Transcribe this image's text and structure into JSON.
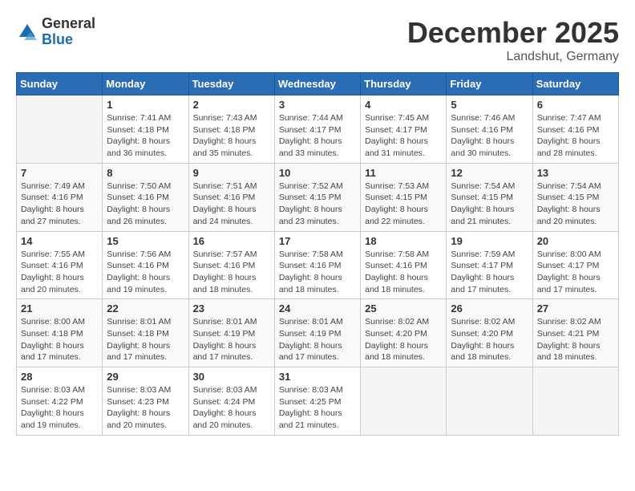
{
  "logo": {
    "general": "General",
    "blue": "Blue"
  },
  "title": "December 2025",
  "location": "Landshut, Germany",
  "weekdays": [
    "Sunday",
    "Monday",
    "Tuesday",
    "Wednesday",
    "Thursday",
    "Friday",
    "Saturday"
  ],
  "weeks": [
    [
      {
        "day": "",
        "info": ""
      },
      {
        "day": "1",
        "info": "Sunrise: 7:41 AM\nSunset: 4:18 PM\nDaylight: 8 hours\nand 36 minutes."
      },
      {
        "day": "2",
        "info": "Sunrise: 7:43 AM\nSunset: 4:18 PM\nDaylight: 8 hours\nand 35 minutes."
      },
      {
        "day": "3",
        "info": "Sunrise: 7:44 AM\nSunset: 4:17 PM\nDaylight: 8 hours\nand 33 minutes."
      },
      {
        "day": "4",
        "info": "Sunrise: 7:45 AM\nSunset: 4:17 PM\nDaylight: 8 hours\nand 31 minutes."
      },
      {
        "day": "5",
        "info": "Sunrise: 7:46 AM\nSunset: 4:16 PM\nDaylight: 8 hours\nand 30 minutes."
      },
      {
        "day": "6",
        "info": "Sunrise: 7:47 AM\nSunset: 4:16 PM\nDaylight: 8 hours\nand 28 minutes."
      }
    ],
    [
      {
        "day": "7",
        "info": "Sunrise: 7:49 AM\nSunset: 4:16 PM\nDaylight: 8 hours\nand 27 minutes."
      },
      {
        "day": "8",
        "info": "Sunrise: 7:50 AM\nSunset: 4:16 PM\nDaylight: 8 hours\nand 26 minutes."
      },
      {
        "day": "9",
        "info": "Sunrise: 7:51 AM\nSunset: 4:16 PM\nDaylight: 8 hours\nand 24 minutes."
      },
      {
        "day": "10",
        "info": "Sunrise: 7:52 AM\nSunset: 4:15 PM\nDaylight: 8 hours\nand 23 minutes."
      },
      {
        "day": "11",
        "info": "Sunrise: 7:53 AM\nSunset: 4:15 PM\nDaylight: 8 hours\nand 22 minutes."
      },
      {
        "day": "12",
        "info": "Sunrise: 7:54 AM\nSunset: 4:15 PM\nDaylight: 8 hours\nand 21 minutes."
      },
      {
        "day": "13",
        "info": "Sunrise: 7:54 AM\nSunset: 4:15 PM\nDaylight: 8 hours\nand 20 minutes."
      }
    ],
    [
      {
        "day": "14",
        "info": "Sunrise: 7:55 AM\nSunset: 4:16 PM\nDaylight: 8 hours\nand 20 minutes."
      },
      {
        "day": "15",
        "info": "Sunrise: 7:56 AM\nSunset: 4:16 PM\nDaylight: 8 hours\nand 19 minutes."
      },
      {
        "day": "16",
        "info": "Sunrise: 7:57 AM\nSunset: 4:16 PM\nDaylight: 8 hours\nand 18 minutes."
      },
      {
        "day": "17",
        "info": "Sunrise: 7:58 AM\nSunset: 4:16 PM\nDaylight: 8 hours\nand 18 minutes."
      },
      {
        "day": "18",
        "info": "Sunrise: 7:58 AM\nSunset: 4:16 PM\nDaylight: 8 hours\nand 18 minutes."
      },
      {
        "day": "19",
        "info": "Sunrise: 7:59 AM\nSunset: 4:17 PM\nDaylight: 8 hours\nand 17 minutes."
      },
      {
        "day": "20",
        "info": "Sunrise: 8:00 AM\nSunset: 4:17 PM\nDaylight: 8 hours\nand 17 minutes."
      }
    ],
    [
      {
        "day": "21",
        "info": "Sunrise: 8:00 AM\nSunset: 4:18 PM\nDaylight: 8 hours\nand 17 minutes."
      },
      {
        "day": "22",
        "info": "Sunrise: 8:01 AM\nSunset: 4:18 PM\nDaylight: 8 hours\nand 17 minutes."
      },
      {
        "day": "23",
        "info": "Sunrise: 8:01 AM\nSunset: 4:19 PM\nDaylight: 8 hours\nand 17 minutes."
      },
      {
        "day": "24",
        "info": "Sunrise: 8:01 AM\nSunset: 4:19 PM\nDaylight: 8 hours\nand 17 minutes."
      },
      {
        "day": "25",
        "info": "Sunrise: 8:02 AM\nSunset: 4:20 PM\nDaylight: 8 hours\nand 18 minutes."
      },
      {
        "day": "26",
        "info": "Sunrise: 8:02 AM\nSunset: 4:20 PM\nDaylight: 8 hours\nand 18 minutes."
      },
      {
        "day": "27",
        "info": "Sunrise: 8:02 AM\nSunset: 4:21 PM\nDaylight: 8 hours\nand 18 minutes."
      }
    ],
    [
      {
        "day": "28",
        "info": "Sunrise: 8:03 AM\nSunset: 4:22 PM\nDaylight: 8 hours\nand 19 minutes."
      },
      {
        "day": "29",
        "info": "Sunrise: 8:03 AM\nSunset: 4:23 PM\nDaylight: 8 hours\nand 20 minutes."
      },
      {
        "day": "30",
        "info": "Sunrise: 8:03 AM\nSunset: 4:24 PM\nDaylight: 8 hours\nand 20 minutes."
      },
      {
        "day": "31",
        "info": "Sunrise: 8:03 AM\nSunset: 4:25 PM\nDaylight: 8 hours\nand 21 minutes."
      },
      {
        "day": "",
        "info": ""
      },
      {
        "day": "",
        "info": ""
      },
      {
        "day": "",
        "info": ""
      }
    ]
  ]
}
